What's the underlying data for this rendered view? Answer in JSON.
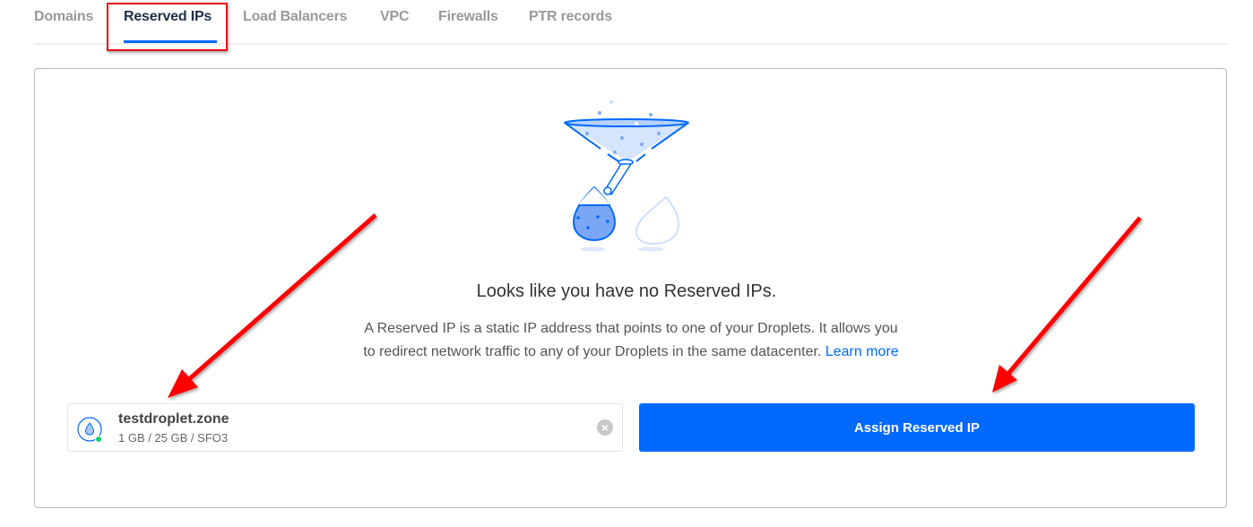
{
  "tabs": [
    {
      "label": "Domains",
      "active": false
    },
    {
      "label": "Reserved IPs",
      "active": true
    },
    {
      "label": "Load Balancers",
      "active": false
    },
    {
      "label": "VPC",
      "active": false
    },
    {
      "label": "Firewalls",
      "active": false
    },
    {
      "label": "PTR records",
      "active": false
    }
  ],
  "empty_state": {
    "illustration": "funnel-droplet-illustration",
    "heading": "Looks like you have no Reserved IPs.",
    "description_line1": "A Reserved IP is a static IP address that points to one of your Droplets. It allows you",
    "description_line2": "to redirect network traffic to any of your Droplets in the same datacenter.",
    "learn_more": "Learn more"
  },
  "droplet_select": {
    "name": "testdroplet.zone",
    "meta": "1 GB / 25 GB / SFO3",
    "status": "active",
    "status_color": "#15cd72",
    "clear_icon": "close-circle-icon"
  },
  "assign_button": {
    "label": "Assign Reserved IP"
  },
  "annotations": {
    "color": "#ff0000",
    "highlight": "Reserved IPs tab",
    "arrows": [
      "droplet-select",
      "assign-button"
    ]
  },
  "colors": {
    "accent": "#0069ff",
    "heading": "#333333",
    "tab_active": "#1f2f4a",
    "tab_inactive": "#999999"
  }
}
